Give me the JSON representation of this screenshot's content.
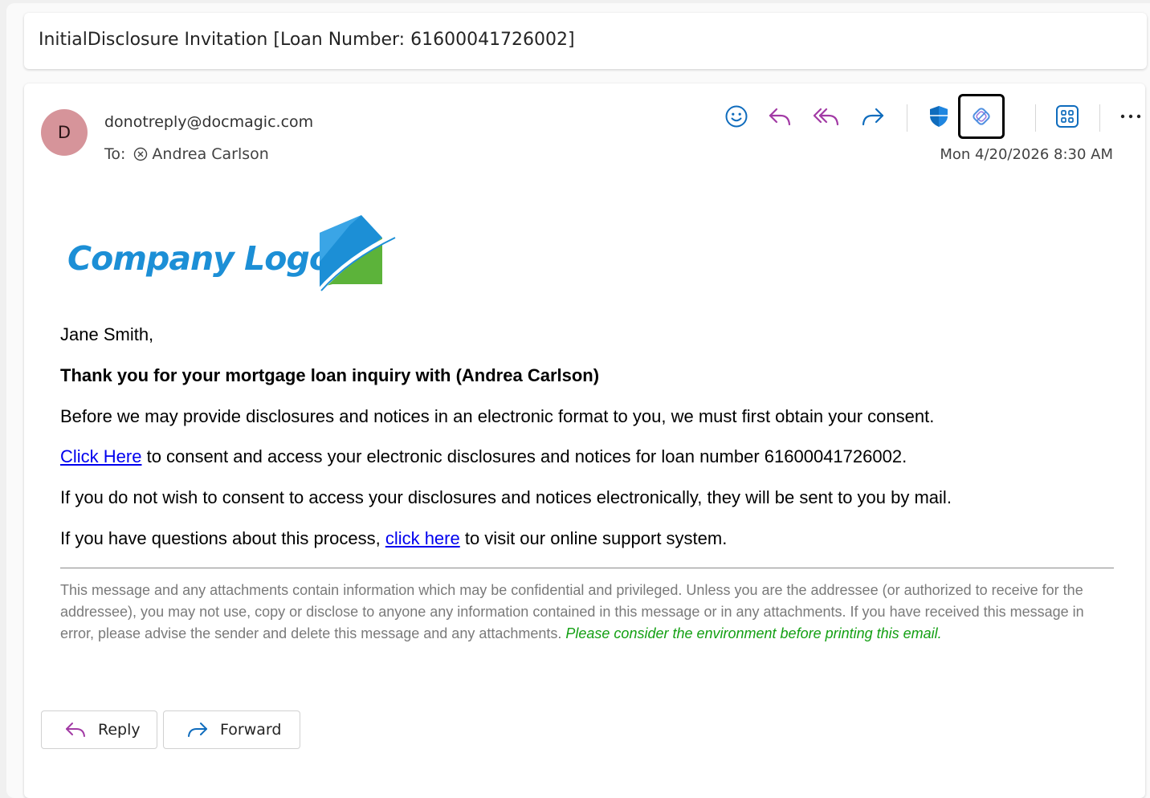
{
  "subject": "InitialDisclosure Invitation [Loan Number: 61600041726002]",
  "sender": {
    "initial": "D",
    "email": "donotreply@docmagic.com",
    "avatar_color": "#d6949a"
  },
  "recipients": {
    "to_label": "To:",
    "name": "Andrea Carlson"
  },
  "datetime": "Mon 4/20/2026 8:30 AM",
  "toolbar": {
    "icons": [
      "emoji-icon",
      "reply-icon",
      "reply-all-icon",
      "forward-icon",
      "shield-icon",
      "tag-icon",
      "apps-icon",
      "more-icon"
    ],
    "accent": "#0f6cbd",
    "reply_all_color": "#a23aa5"
  },
  "logo": {
    "text": "Company Logo",
    "blue": "#1c8fd6",
    "green": "#5cb33a"
  },
  "body": {
    "greeting": "Jane Smith,",
    "thanks": "Thank you for your mortgage loan inquiry with (Andrea Carlson)",
    "consent_intro": "Before we may provide disclosures and notices in an electronic format to you, we must first obtain your consent.",
    "consent_link": "Click Here",
    "consent_rest": " to consent and access your electronic disclosures and notices for loan number 61600041726002.",
    "mail_notice": "If you do not wish to consent to access your disclosures and notices electronically, they will be sent to you by mail.",
    "support_pre": "If you have questions about this process, ",
    "support_link": "click here",
    "support_post": " to visit our online support system."
  },
  "disclaimer": {
    "text": "This message and any attachments contain information which may be confidential and privileged. Unless you are the addressee (or authorized to receive for the addressee), you may not use, copy or disclose to anyone any information contained in this message or in any attachments. If you have received this message in error, please advise the sender and delete this message and any attachments. ",
    "green_text": "Please consider the environment before printing this email."
  },
  "actions": {
    "reply_label": "Reply",
    "forward_label": "Forward"
  }
}
